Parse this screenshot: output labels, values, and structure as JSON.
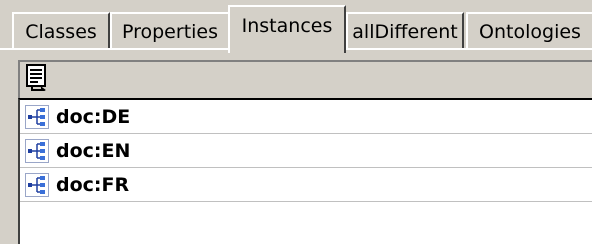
{
  "tabs": [
    {
      "label": "Classes",
      "active": false
    },
    {
      "label": "Properties",
      "active": false
    },
    {
      "label": "Instances",
      "active": true
    },
    {
      "label": "allDifferent",
      "active": false
    },
    {
      "label": "Ontologies",
      "active": false
    }
  ],
  "toolbar": {
    "buttons": [
      {
        "icon": "add-instance-icon"
      }
    ]
  },
  "instances": [
    {
      "label": "doc:DE",
      "icon": "instance-icon"
    },
    {
      "label": "doc:EN",
      "icon": "instance-icon"
    },
    {
      "label": "doc:FR",
      "icon": "instance-icon"
    }
  ]
}
